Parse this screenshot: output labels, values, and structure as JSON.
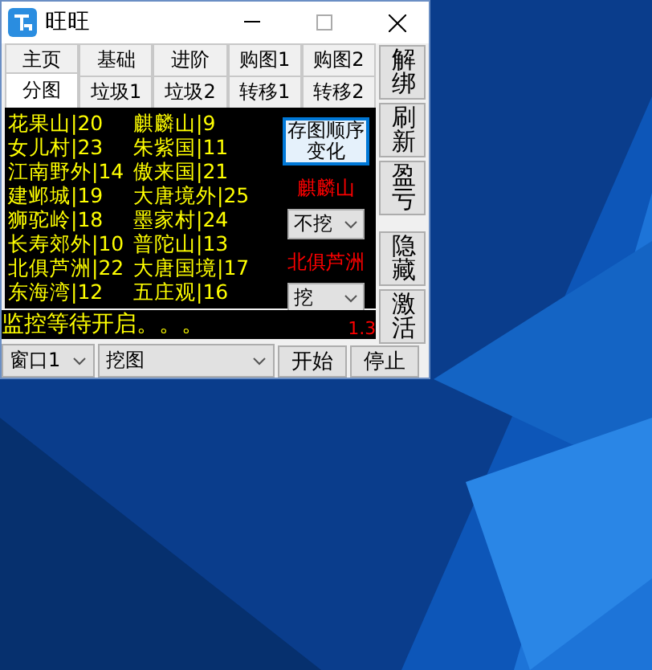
{
  "window": {
    "title": "旺旺"
  },
  "tabs": [
    [
      {
        "label": "主页",
        "selected": false
      },
      {
        "label": "基础",
        "selected": false
      },
      {
        "label": "进阶",
        "selected": false
      },
      {
        "label": "购图1",
        "selected": false
      },
      {
        "label": "购图2",
        "selected": false
      }
    ],
    [
      {
        "label": "分图",
        "selected": true
      },
      {
        "label": "垃圾1",
        "selected": false
      },
      {
        "label": "垃圾2",
        "selected": false
      },
      {
        "label": "转移1",
        "selected": false
      },
      {
        "label": "转移2",
        "selected": false
      }
    ]
  ],
  "maps": {
    "column_1": [
      "花果山|20",
      "女儿村|23",
      "江南野外|14",
      "建邺城|19",
      "狮驼岭|18",
      "长寿郊外|10",
      "北俱芦洲|22",
      "东海湾|12"
    ],
    "column_2": [
      "麒麟山|9",
      "朱紫国|11",
      "傲来国|21",
      "大唐境外|25",
      "墨家村|24",
      "普陀山|13",
      "大唐国境|17",
      "五庄观|16"
    ]
  },
  "panel": {
    "button": "存图顺序变化",
    "map_1": "麒麟山",
    "select_1": "不挖",
    "map_2": "北俱芦洲",
    "select_2": "挖"
  },
  "side_buttons": [
    "解绑",
    "刷新",
    "盈亏",
    "隐藏",
    "激活"
  ],
  "status": {
    "text": "监控等待开启。。。",
    "version": "1.3"
  },
  "bottom": {
    "window_select": "窗口1",
    "mode_select": "挖图",
    "buttons": [
      "开始",
      "停止"
    ]
  }
}
